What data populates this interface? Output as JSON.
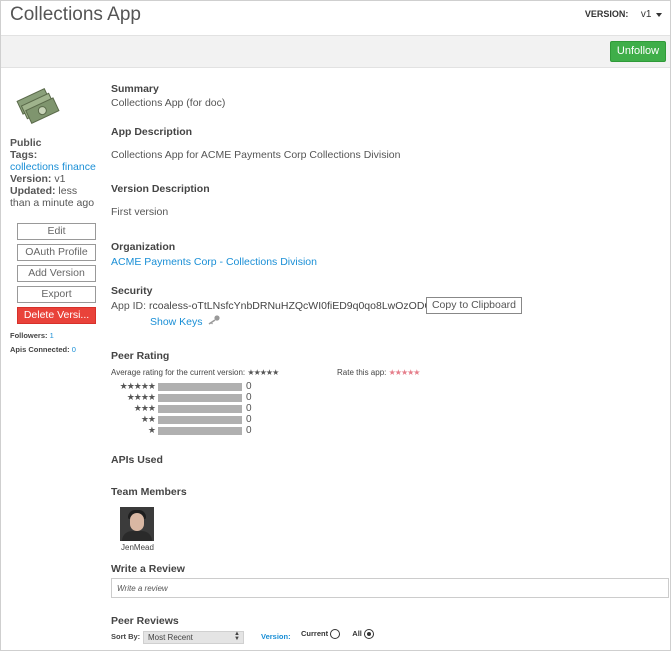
{
  "header": {
    "title": "Collections App",
    "version_label": "VERSION:",
    "version_value": "v1"
  },
  "toolbar": {
    "unfollow_label": "Unfollow"
  },
  "sidebar": {
    "visibility": "Public",
    "tags_label": "Tags:",
    "tags_value": "collections finance",
    "version_label": "Version:",
    "version_value": "v1",
    "updated_label": "Updated:",
    "updated_value": "less than a minute ago",
    "buttons": [
      "Edit",
      "OAuth Profile",
      "Add Version",
      "Export",
      "Delete Versi..."
    ],
    "followers_label": "Followers:",
    "followers_value": "1",
    "apis_label": "Apis Connected:",
    "apis_value": "0"
  },
  "main": {
    "summary_heading": "Summary",
    "summary_text": "Collections App (for doc)",
    "app_desc_heading": "App Description",
    "app_desc_text": "Collections App for ACME Payments Corp Collections Division",
    "version_desc_heading": "Version Description",
    "version_desc_text": "First version",
    "org_heading": "Organization",
    "org_link": "ACME Payments Corp - Collections Division",
    "security_heading": "Security",
    "app_id_label": "App ID:",
    "app_id_value": "rcoaless-oTtLNsfcYnbDRNuHZQcWI0fiED9q0qo8LwOzODCf",
    "copy_label": "Copy to Clipboard",
    "show_keys_label": "Show Keys",
    "peer_rating_heading": "Peer Rating",
    "avg_rating_label": "Average rating for the current version:",
    "avg_rating_stars": "★★★★★",
    "rate_app_label": "Rate this app:",
    "rate_app_stars": "★★★★★",
    "rating_rows": [
      {
        "stars": "★★★★★",
        "count": "0"
      },
      {
        "stars": "★★★★",
        "count": "0"
      },
      {
        "stars": "★★★",
        "count": "0"
      },
      {
        "stars": "★★",
        "count": "0"
      },
      {
        "stars": "★",
        "count": "0"
      }
    ],
    "apis_used_heading": "APIs Used",
    "team_heading": "Team Members",
    "team_member_name": "JenMead",
    "write_review_heading": "Write a Review",
    "review_placeholder": "Write a review",
    "peer_reviews_heading": "Peer Reviews",
    "sort_by_label": "Sort By:",
    "sort_value": "Most Recent",
    "version_filter_label": "Version:",
    "current_label": "Current",
    "all_label": "All"
  }
}
